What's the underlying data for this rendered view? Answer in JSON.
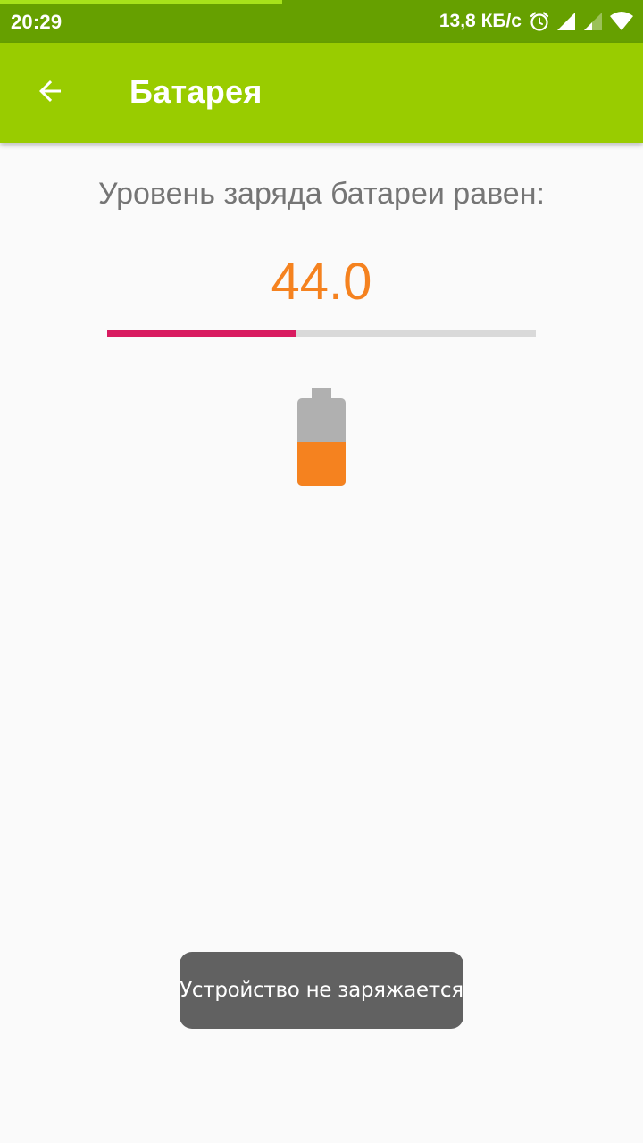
{
  "status_bar": {
    "time": "20:29",
    "network_speed": "13,8 КБ/с",
    "icons": [
      "alarm-icon",
      "signal-icon",
      "signal-weak-icon",
      "wifi-icon"
    ],
    "color": "#66a000"
  },
  "app_bar": {
    "title": "Батарея",
    "back_icon": "arrow-left-icon",
    "color": "#99cc00"
  },
  "battery": {
    "label": "Уровень заряда батареи равен:",
    "level_text": "44.0",
    "level_percent": 44,
    "value_color": "#f5821f",
    "progress_color": "#d81b60",
    "icon": "battery-icon"
  },
  "toast": {
    "message": "Устройство не заряжается"
  }
}
